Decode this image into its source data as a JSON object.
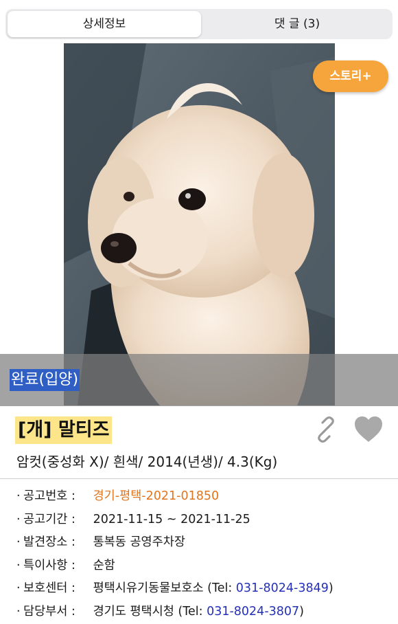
{
  "tabs": [
    {
      "label": "상세정보",
      "active": true
    },
    {
      "label": "댓 글 (3)",
      "active": false
    }
  ],
  "photo": {
    "story_button": "스토리+",
    "status_label": "완료(입양)"
  },
  "animal": {
    "title": "[개] 말티즈",
    "description": "암컷(중성화 X)/ 흰색/ 2014(년생)/ 4.3(Kg)"
  },
  "info": {
    "notice_no": {
      "label": "공고번호 :",
      "value": "경기-평택-2021-01850"
    },
    "period": {
      "label": "공고기간 :",
      "value": "2021-11-15 ~ 2021-11-25"
    },
    "found_place": {
      "label": "발견장소 :",
      "value": "통복동 공영주차장"
    },
    "notes": {
      "label": "특이사항 :",
      "value": "순함"
    },
    "shelter": {
      "label": "보호센터 :",
      "name": "평택시유기동물보호소",
      "tel_prefix": "(Tel: ",
      "tel": "031-8024-3849",
      "tel_suffix": ")"
    },
    "department": {
      "label": "담당부서 :",
      "name": "경기도 평택시청",
      "tel_prefix": "(Tel: ",
      "tel": "031-8024-3807",
      "tel_suffix": ")"
    }
  },
  "icons": {
    "share": "link-icon",
    "favorite": "heart-icon"
  },
  "colors": {
    "story_button": "#f5a53b",
    "title_highlight": "#fde58a",
    "notice_value": "#e0751e",
    "phone_link": "#2430b8",
    "status_selection": "#2f5fc4"
  }
}
